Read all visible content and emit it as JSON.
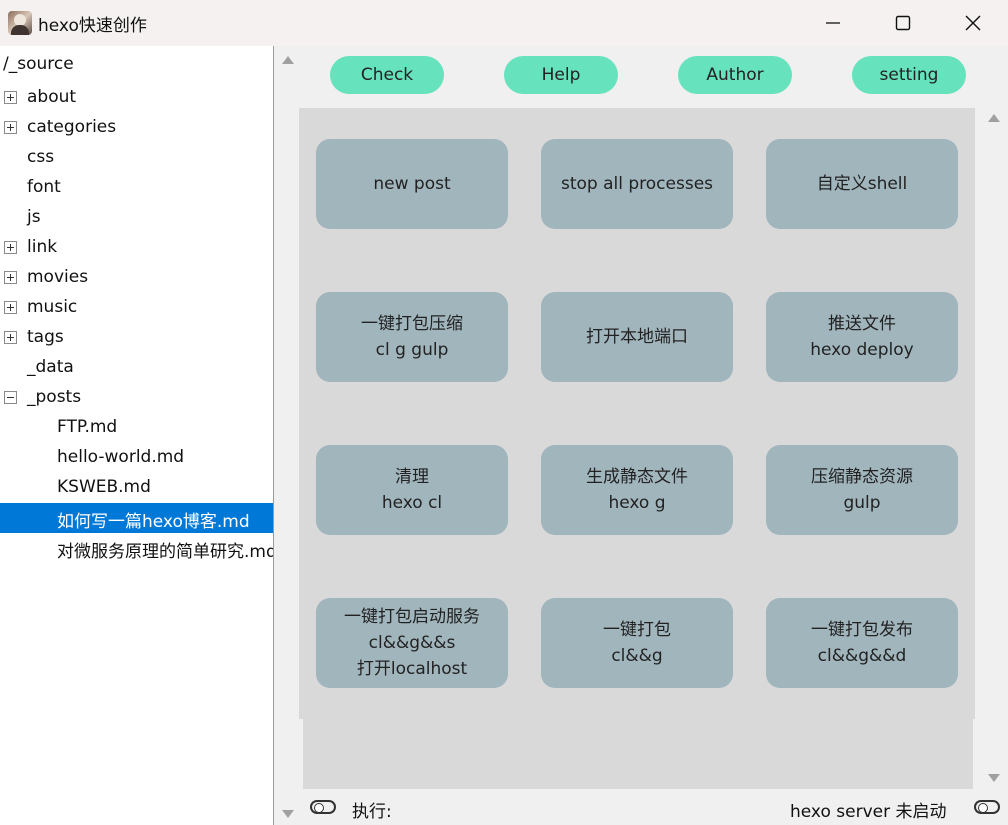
{
  "window": {
    "title": "hexo快速创作",
    "minimize_icon": "minimize-icon",
    "maximize_icon": "maximize-icon",
    "close_icon": "close-icon"
  },
  "tree": {
    "root": "/_source",
    "items": [
      {
        "label": "about",
        "expander": "plus"
      },
      {
        "label": "categories",
        "expander": "plus"
      },
      {
        "label": "css",
        "expander": "none"
      },
      {
        "label": "font",
        "expander": "none"
      },
      {
        "label": "js",
        "expander": "none"
      },
      {
        "label": "link",
        "expander": "plus"
      },
      {
        "label": "movies",
        "expander": "plus"
      },
      {
        "label": "music",
        "expander": "plus"
      },
      {
        "label": "tags",
        "expander": "plus"
      },
      {
        "label": "_data",
        "expander": "none"
      },
      {
        "label": "_posts",
        "expander": "minus"
      },
      {
        "label": "FTP.md",
        "expander": "child"
      },
      {
        "label": "hello-world.md",
        "expander": "child"
      },
      {
        "label": "KSWEB.md",
        "expander": "child"
      },
      {
        "label": "如何写一篇hexo博客.md",
        "expander": "child",
        "selected": true
      },
      {
        "label": "对微服务原理的简单研究.md",
        "expander": "child"
      }
    ]
  },
  "top_buttons": [
    "Check",
    "Help",
    "Author",
    "setting"
  ],
  "actions": [
    {
      "lines": [
        "new post"
      ]
    },
    {
      "lines": [
        "stop all processes"
      ]
    },
    {
      "lines": [
        "自定义shell"
      ]
    },
    {
      "lines": [
        "一键打包压缩",
        "cl g gulp"
      ]
    },
    {
      "lines": [
        "打开本地端口"
      ]
    },
    {
      "lines": [
        "推送文件",
        "hexo deploy"
      ]
    },
    {
      "lines": [
        "清理",
        "hexo cl"
      ]
    },
    {
      "lines": [
        "生成静态文件",
        "hexo g"
      ]
    },
    {
      "lines": [
        "压缩静态资源",
        "gulp"
      ]
    },
    {
      "lines": [
        "一键打包启动服务",
        "cl&&g&&s",
        "打开localhost"
      ]
    },
    {
      "lines": [
        "一键打包",
        "cl&&g"
      ]
    },
    {
      "lines": [
        "一键打包发布",
        "cl&&g&&d"
      ]
    }
  ],
  "status": {
    "label": "执行:",
    "server": "hexo server 未启动"
  },
  "colors": {
    "accent_button": "#66e3bd",
    "action_button": "#a1b5bd",
    "panel": "#d9d9d9",
    "selection": "#0078d7"
  }
}
